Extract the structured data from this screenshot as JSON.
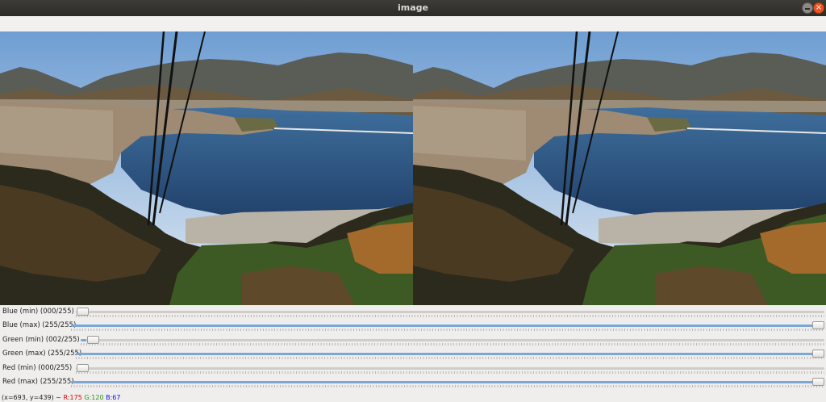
{
  "window": {
    "title": "image"
  },
  "trackbars": [
    {
      "label": "Blue (min)  (000/255)",
      "value": 0,
      "max": 255
    },
    {
      "label": "Blue (max)  (255/255)",
      "value": 255,
      "max": 255
    },
    {
      "label": "Green (min)  (002/255)",
      "value": 2,
      "max": 255
    },
    {
      "label": "Green (max)  (255/255)",
      "value": 255,
      "max": 255
    },
    {
      "label": "Red (min)   (000/255)",
      "value": 0,
      "max": 255
    },
    {
      "label": "Red (max)   (255/255)",
      "value": 255,
      "max": 255
    }
  ],
  "status": {
    "coords": "(x=693, y=439) ~",
    "r": "R:175",
    "g": "G:120",
    "b": "B:67"
  },
  "colors": {
    "r": "#d80000",
    "g": "#2f8f1f",
    "b": "#1010e0",
    "track_fill": "#7aa7d6"
  }
}
